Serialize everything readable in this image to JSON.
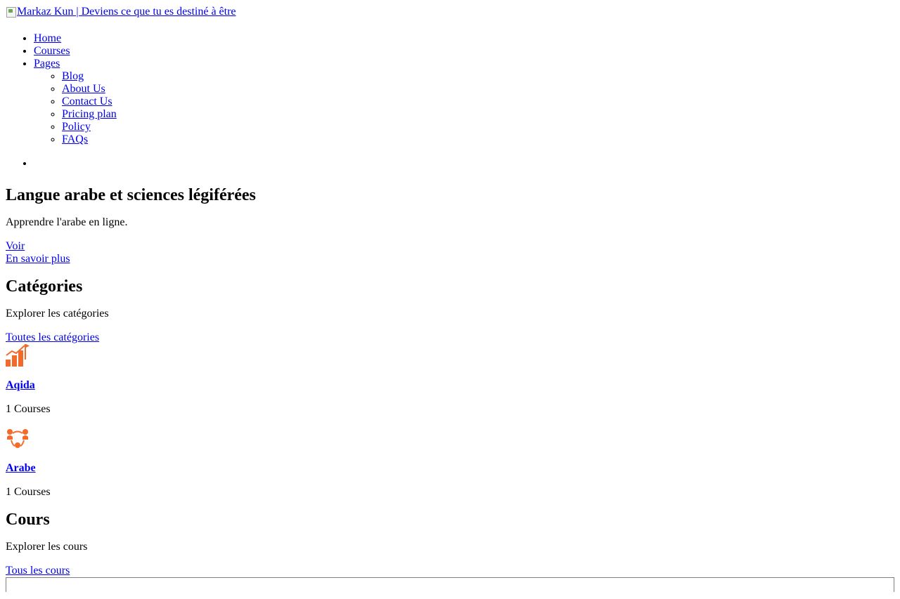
{
  "header": {
    "logo_alt": "Markaz Kun | Deviens ce que tu es destiné à être"
  },
  "nav": {
    "items": [
      {
        "label": "Home"
      },
      {
        "label": "Courses"
      },
      {
        "label": "Pages"
      }
    ],
    "pages_sub": [
      {
        "label": "Blog"
      },
      {
        "label": "About Us"
      },
      {
        "label": "Contact Us"
      },
      {
        "label": "Pricing plan"
      },
      {
        "label": "Policy"
      },
      {
        "label": "FAQs"
      }
    ]
  },
  "hero": {
    "title": "Langue arabe et sciences légiférées",
    "subtitle": "Apprendre l'arabe en ligne.",
    "view_label": "Voir",
    "more_label": "En savoir plus"
  },
  "categories": {
    "title": "Catégories",
    "subtitle": "Explorer les catégories",
    "all_label": "Toutes les catégories",
    "items": [
      {
        "name": "Aqida",
        "count": "1 Courses",
        "icon": "growth-chart-icon",
        "color": "#f26b2a"
      },
      {
        "name": "Arabe",
        "count": "1 Courses",
        "icon": "team-network-icon",
        "color": "#f26b2a"
      }
    ]
  },
  "courses": {
    "title": "Cours",
    "subtitle": "Explorer les cours",
    "all_label": "Tous les cours"
  }
}
